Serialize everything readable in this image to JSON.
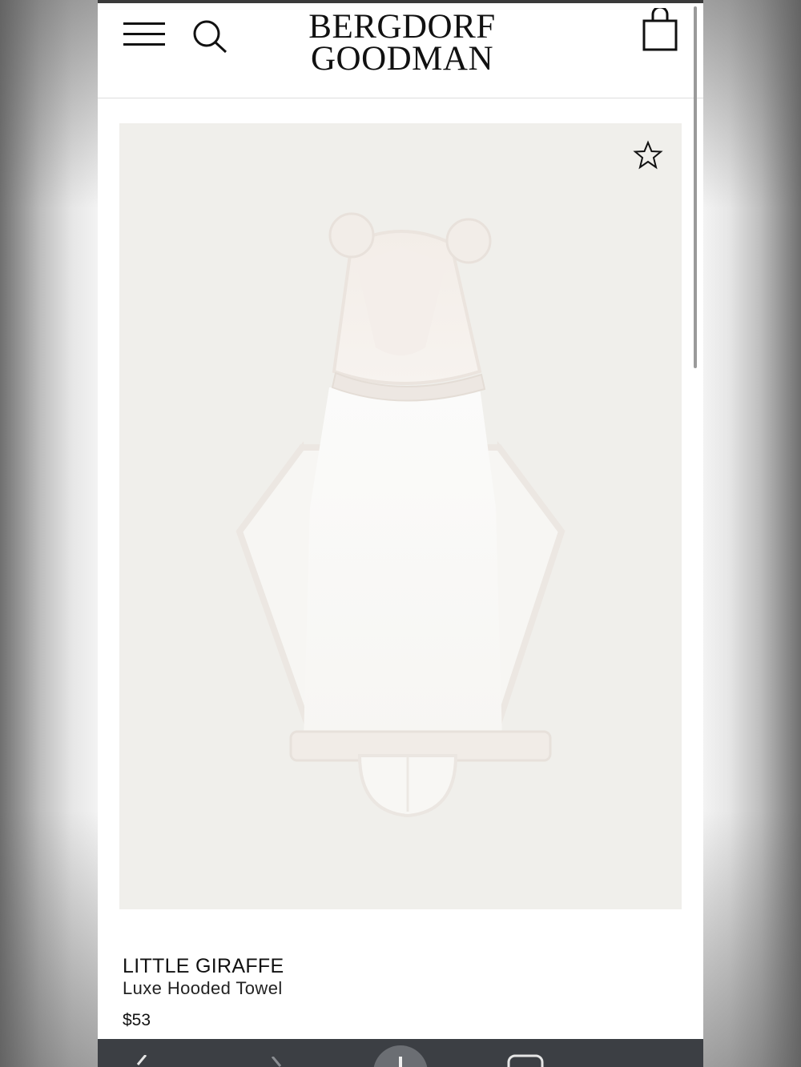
{
  "header": {
    "logo_line1": "BERGDORF",
    "logo_line2": "GOODMAN",
    "icons": {
      "menu": "hamburger-menu-icon",
      "search": "search-icon",
      "cart": "shopping-bag-icon"
    }
  },
  "product": {
    "brand": "LITTLE GIRAFFE",
    "name": "Luxe Hooded Towel",
    "price": "$53",
    "image_alt": "white hooded baby towel with bear ears",
    "wishlist_icon": "star-outline-icon",
    "image_background": "#f0efeb"
  },
  "browser_toolbar": {
    "background": "#3c3f44",
    "icons": [
      "back-arrow-icon",
      "forward-arrow-icon",
      "new-tab-plus-icon",
      "tabs-icon"
    ]
  }
}
